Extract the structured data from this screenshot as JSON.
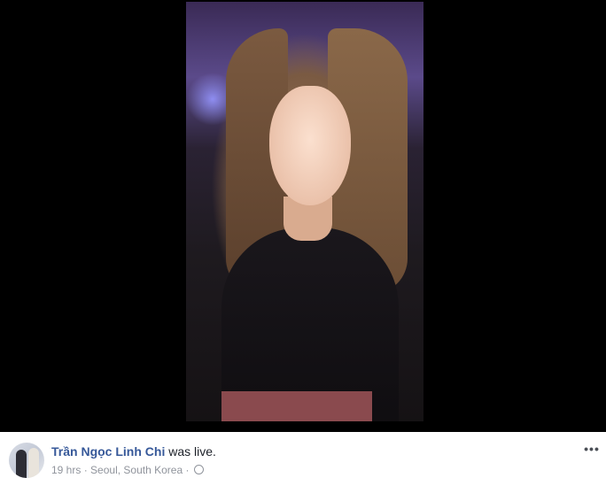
{
  "post": {
    "author_name": "Trần Ngọc Linh Chi",
    "status_text": "was live.",
    "time": "19 hrs",
    "separator": "·",
    "location": "Seoul, South Korea",
    "separator2": "·",
    "privacy_icon": "globe-icon",
    "more_options_label": "•••"
  },
  "video": {
    "type": "live-video-recording"
  }
}
